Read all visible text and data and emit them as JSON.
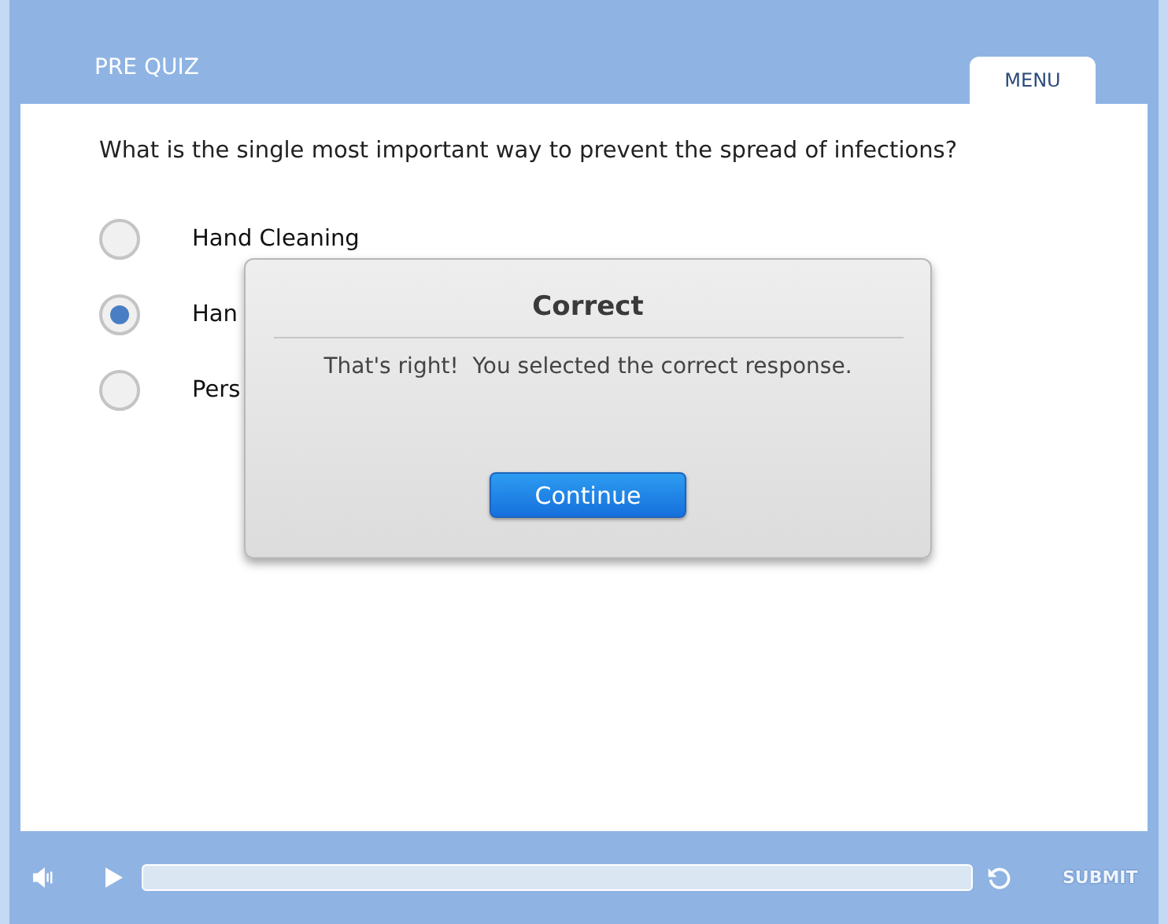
{
  "header": {
    "title": "PRE QUIZ",
    "menu_tab": "MENU"
  },
  "question": "What is the single most important way to prevent the spread of infections?",
  "options": [
    {
      "label": "Hand Cleaning",
      "selected": false
    },
    {
      "label": "Han",
      "selected": true
    },
    {
      "label": "Pers",
      "selected": false
    }
  ],
  "dialog": {
    "title": "Correct",
    "message": "That's right!  You selected the correct response.",
    "button": "Continue"
  },
  "player": {
    "progress": {
      "level": 0
    },
    "submit": {
      "label": "SUBMIT",
      "disabled": true
    }
  }
}
